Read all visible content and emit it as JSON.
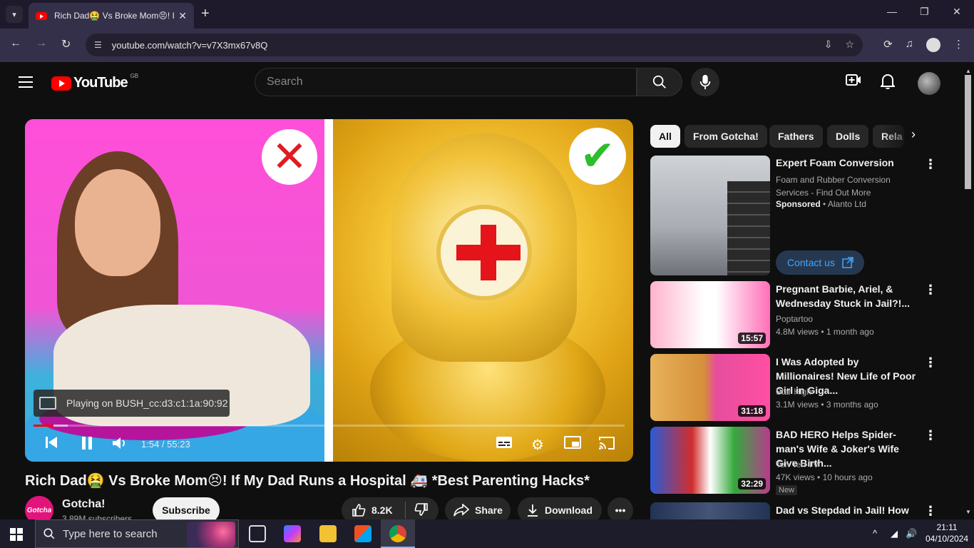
{
  "browser": {
    "tab_title": "Rich Dad🤮 Vs Broke Mom😣! If My Dad",
    "url": "youtube.com/watch?v=v7X3mx67v8Q"
  },
  "header": {
    "logo_text": "YouTube",
    "country_code": "GB",
    "search_placeholder": "Search"
  },
  "player": {
    "cast_status": "Playing on BUSH_cc:d3:c1:1a:90:92",
    "time": "1:54 / 55:23",
    "progress_fraction": 0.034,
    "loaded_fraction": 0.058
  },
  "video": {
    "title": "Rich Dad🤮 Vs Broke Mom😣! If My Dad Runs a Hospital 🚑 *Best Parenting Hacks*",
    "channel_name": "Gotcha!",
    "channel_avatar_text": "Gotcha",
    "subscribers": "3.89M subscribers",
    "subscribe_label": "Subscribe",
    "likes": "8.2K",
    "share_label": "Share",
    "download_label": "Download"
  },
  "chips": [
    "All",
    "From Gotcha!",
    "Fathers",
    "Dolls",
    "Rela"
  ],
  "ad": {
    "title": "Expert Foam Conversion",
    "description": "Foam and Rubber Conversion Services - Find Out More",
    "sponsored_label": "Sponsored",
    "advertiser": "Alanto Ltd",
    "cta": "Contact us"
  },
  "recommendations": [
    {
      "title": "Pregnant Barbie, Ariel, & Wednesday Stuck in Jail?!...",
      "channel": "Poptartoo",
      "views": "4.8M views",
      "age": "1 month ago",
      "duration": "15:57"
    },
    {
      "title": "I Was Adopted by Millionaires! New Life of Poor Girl in Giga...",
      "channel": "Star High",
      "views": "3.1M views",
      "age": "3 months ago",
      "duration": "31:18"
    },
    {
      "title": "BAD HERO Helps Spider-man's Wife & Joker's Wife Give Birth...",
      "channel": "Ten Ten TV",
      "views": "47K views",
      "age": "10 hours ago",
      "duration": "32:29",
      "badge": "New"
    },
    {
      "title": "Dad vs Stepdad in Jail! How to"
    }
  ],
  "taskbar": {
    "search_placeholder": "Type here to search",
    "time": "21:11",
    "date": "04/10/2024"
  },
  "colors": {
    "brand_red": "#ff0000",
    "background": "#0f0f0f",
    "link_blue": "#3ea6ff"
  }
}
